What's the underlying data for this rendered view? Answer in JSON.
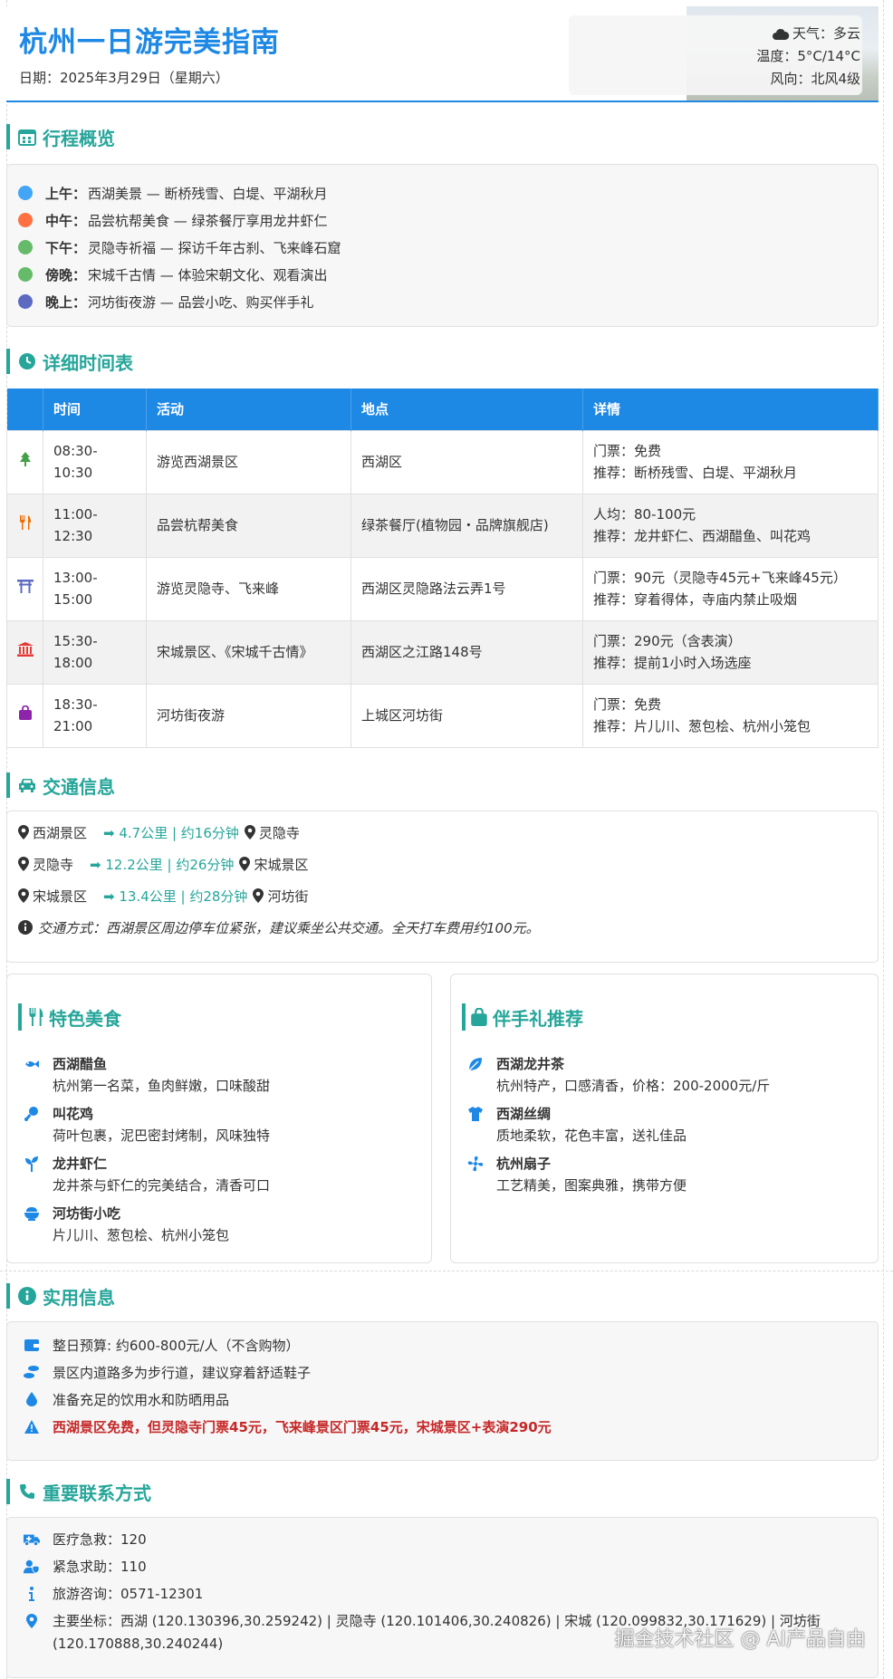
{
  "header": {
    "title": "杭州一日游完美指南",
    "date": "日期：2025年3月29日（星期六）",
    "weather": "天气：多云",
    "temperature": "温度：5°C/14°C",
    "wind": "风向：北风4级"
  },
  "overview": {
    "title": "行程概览",
    "items": [
      {
        "period": "上午：",
        "text": "西湖美景 — 断桥残雪、白堤、平湖秋月",
        "color": "#42a5f5"
      },
      {
        "period": "中午：",
        "text": "品尝杭帮美食 — 绿茶餐厅享用龙井虾仁",
        "color": "#ff7043"
      },
      {
        "period": "下午：",
        "text": "灵隐寺祈福 — 探访千年古刹、飞来峰石窟",
        "color": "#66bb6a"
      },
      {
        "period": "傍晚：",
        "text": "宋城千古情 — 体验宋朝文化、观看演出",
        "color": "#66bb6a"
      },
      {
        "period": "晚上：",
        "text": "河坊街夜游 — 品尝小吃、购买伴手礼",
        "color": "#5c6bc0"
      }
    ]
  },
  "schedule": {
    "title": "详细时间表",
    "headers": [
      "时间",
      "活动",
      "地点",
      "详情"
    ],
    "rows": [
      {
        "icon": "tree-icon",
        "time": "08:30-10:30",
        "activity": "游览西湖景区",
        "location": "西湖区",
        "detail1": "门票：免费",
        "detail2": "推荐：断桥残雪、白堤、平湖秋月"
      },
      {
        "icon": "utensils-icon",
        "time": "11:00-12:30",
        "activity": "品尝杭帮美食",
        "location": "绿茶餐厅(植物园・品牌旗舰店)",
        "detail1": "人均：80-100元",
        "detail2": "推荐：龙井虾仁、西湖醋鱼、叫花鸡"
      },
      {
        "icon": "torii-gate-icon",
        "time": "13:00-15:00",
        "activity": "游览灵隐寺、飞来峰",
        "location": "西湖区灵隐路法云弄1号",
        "detail1": "门票：90元（灵隐寺45元+飞来峰45元）",
        "detail2": "推荐：穿着得体，寺庙内禁止吸烟"
      },
      {
        "icon": "landmark-icon",
        "time": "15:30-18:00",
        "activity": "宋城景区、《宋城千古情》",
        "location": "西湖区之江路148号",
        "detail1": "门票：290元（含表演）",
        "detail2": "推荐：提前1小时入场选座"
      },
      {
        "icon": "shopping-bag-icon",
        "time": "18:30-21:00",
        "activity": "河坊街夜游",
        "location": "上城区河坊街",
        "detail1": "门票：免费",
        "detail2": "推荐：片儿川、葱包桧、杭州小笼包"
      }
    ]
  },
  "transport": {
    "title": "交通信息",
    "routes": [
      {
        "from": "西湖景区",
        "distance": "➡ 4.7公里 | 约16分钟",
        "to": "灵隐寺"
      },
      {
        "from": "灵隐寺",
        "distance": "➡ 12.2公里 | 约26分钟",
        "to": "宋城景区"
      },
      {
        "from": "宋城景区",
        "distance": "➡ 13.4公里 | 约28分钟",
        "to": "河坊街"
      }
    ],
    "note": "交通方式：西湖景区周边停车位紧张，建议乘坐公共交通。全天打车费用约100元。"
  },
  "food": {
    "title": "特色美食",
    "items": [
      {
        "icon": "fish-icon",
        "name": "西湖醋鱼",
        "desc": "杭州第一名菜，鱼肉鲜嫩，口味酸甜"
      },
      {
        "icon": "drumstick-icon",
        "name": "叫花鸡",
        "desc": "荷叶包裹，泥巴密封烤制，风味独特"
      },
      {
        "icon": "seedling-icon",
        "name": "龙井虾仁",
        "desc": "龙井茶与虾仁的完美结合，清香可口"
      },
      {
        "icon": "bowl-icon",
        "name": "河坊街小吃",
        "desc": "片儿川、葱包桧、杭州小笼包"
      }
    ]
  },
  "gifts": {
    "title": "伴手礼推荐",
    "items": [
      {
        "icon": "leaf-icon",
        "name": "西湖龙井茶",
        "desc": "杭州特产，口感清香，价格：200-2000元/斤"
      },
      {
        "icon": "shirt-icon",
        "name": "西湖丝绸",
        "desc": "质地柔软，花色丰富，送礼佳品"
      },
      {
        "icon": "fan-icon",
        "name": "杭州扇子",
        "desc": "工艺精美，图案典雅，携带方便"
      }
    ]
  },
  "practical": {
    "title": "实用信息",
    "items": [
      {
        "icon": "wallet-icon",
        "text": "整日预算: 约600-800元/人（不含购物）",
        "warn": false
      },
      {
        "icon": "shoe-prints-icon",
        "text": "景区内道路多为步行道，建议穿着舒适鞋子",
        "warn": false
      },
      {
        "icon": "water-drop-icon",
        "text": "准备充足的饮用水和防晒用品",
        "warn": false
      },
      {
        "icon": "warning-icon",
        "text": "西湖景区免费，但灵隐寺门票45元，飞来峰景区门票45元，宋城景区+表演290元",
        "warn": true
      }
    ]
  },
  "contacts": {
    "title": "重要联系方式",
    "items": [
      {
        "icon": "ambulance-icon",
        "text": "医疗急救：120"
      },
      {
        "icon": "police-icon",
        "text": "紧急求助：110"
      },
      {
        "icon": "info-icon",
        "text": "旅游咨询：0571-12301"
      },
      {
        "icon": "location-pin-icon",
        "text": "主要坐标：西湖 (120.130396,30.259242) | 灵隐寺 (120.101406,30.240826) | 宋城 (120.099832,30.171629) | 河坊街 (120.170888,30.240244)"
      }
    ]
  },
  "watermark": "掘金技术社区 @ AI产品自由",
  "colors": {
    "primary": "#1e88e5",
    "accent": "#26a69a",
    "warn": "#c62828"
  }
}
